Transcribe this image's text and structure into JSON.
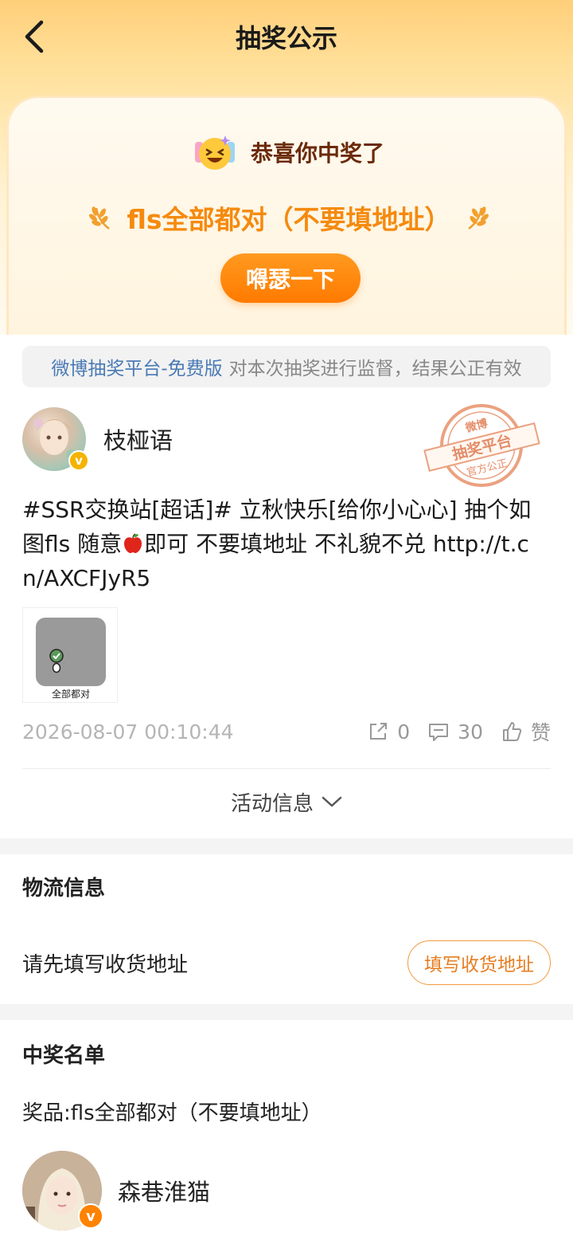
{
  "nav": {
    "title": "抽奖公示"
  },
  "prize_card": {
    "congrats": "恭喜你中奖了",
    "prize_title": "fls全部都对（不要填地址）",
    "brag_button": "嘚瑟一下"
  },
  "notice": {
    "platform": "微博抽奖平台-免费版",
    "rest": "对本次抽奖进行监督，结果公正有效"
  },
  "stamp": {
    "top": "微博",
    "middle": "抽奖平台",
    "bottom": "官方公正"
  },
  "post": {
    "author": "枝桠语",
    "text_before": "#SSR交换站[超话]# 立秋快乐[给你小心心] 抽个如图fls 随意",
    "text_after": "即可 不要填地址 不礼貌不兑  http://t.cn/AXCFJyR5",
    "image_caption": "全部都对",
    "timestamp": "2026-08-07 00:10:44",
    "reposts": "0",
    "comments": "30",
    "likes": "赞"
  },
  "activity": {
    "label": "活动信息"
  },
  "logistics": {
    "title": "物流信息",
    "hint": "请先填写收货地址",
    "button": "填写收货地址"
  },
  "winners": {
    "title": "中奖名单",
    "prize_line": "奖品:fls全部都对（不要填地址）",
    "winner_name": "森巷淮猫"
  },
  "colors": {
    "accent": "#ff8200",
    "prize_orange": "#f58a0e",
    "platform_blue": "#4a7ab5",
    "badge_gold": "#f5b300"
  }
}
